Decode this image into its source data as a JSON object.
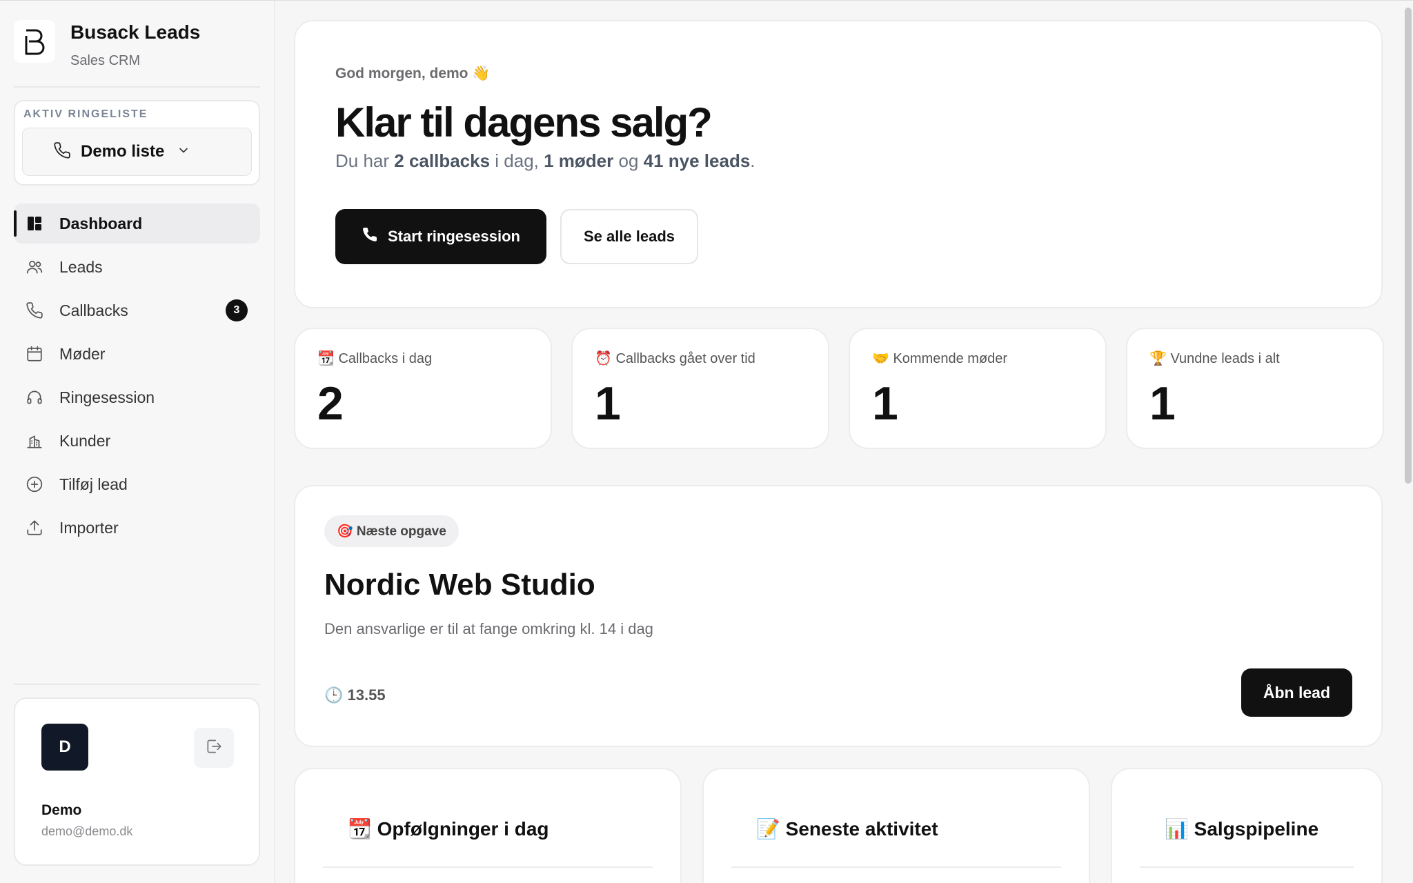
{
  "brand": {
    "title": "Busack Leads",
    "subtitle": "Sales CRM",
    "logo_icon": "b-logo-icon"
  },
  "ringeliste": {
    "label": "AKTIV RINGELISTE",
    "selected": "Demo liste"
  },
  "nav": [
    {
      "label": "Dashboard",
      "icon": "dashboard-icon",
      "active": true
    },
    {
      "label": "Leads",
      "icon": "users-icon"
    },
    {
      "label": "Callbacks",
      "icon": "phone-icon",
      "badge": "3"
    },
    {
      "label": "Møder",
      "icon": "calendar-icon"
    },
    {
      "label": "Ringesession",
      "icon": "headset-icon"
    },
    {
      "label": "Kunder",
      "icon": "building-icon"
    },
    {
      "label": "Tilføj lead",
      "icon": "plus-circle-icon"
    },
    {
      "label": "Importer",
      "icon": "upload-icon"
    }
  ],
  "user": {
    "initial": "D",
    "name": "Demo",
    "email": "demo@demo.dk"
  },
  "hero": {
    "greeting": "God morgen, demo 👋",
    "title": "Klar til dagens salg?",
    "sub_prefix": "Du har ",
    "callbacks": "2 callbacks",
    "sub_mid1": " i dag, ",
    "meetings": "1 møder",
    "sub_mid2": " og ",
    "new_leads": "41 nye leads",
    "sub_suffix": ".",
    "primary_button": "Start ringesession",
    "secondary_button": "Se alle leads"
  },
  "stats": [
    {
      "label": "📆 Callbacks i dag",
      "value": "2"
    },
    {
      "label": "⏰ Callbacks gået over tid",
      "value": "1"
    },
    {
      "label": "🤝 Kommende møder",
      "value": "1"
    },
    {
      "label": "🏆 Vundne leads i alt",
      "value": "1"
    }
  ],
  "task": {
    "chip": "🎯 Næste opgave",
    "title": "Nordic Web Studio",
    "description": "Den ansvarlige er til at fange omkring kl. 14 i dag",
    "time": "🕒 13.55",
    "button": "Åbn lead"
  },
  "panels": [
    {
      "title": "📆 Opfølgninger i dag"
    },
    {
      "title": "📝 Seneste aktivitet"
    },
    {
      "title": "📊 Salgspipeline"
    }
  ]
}
